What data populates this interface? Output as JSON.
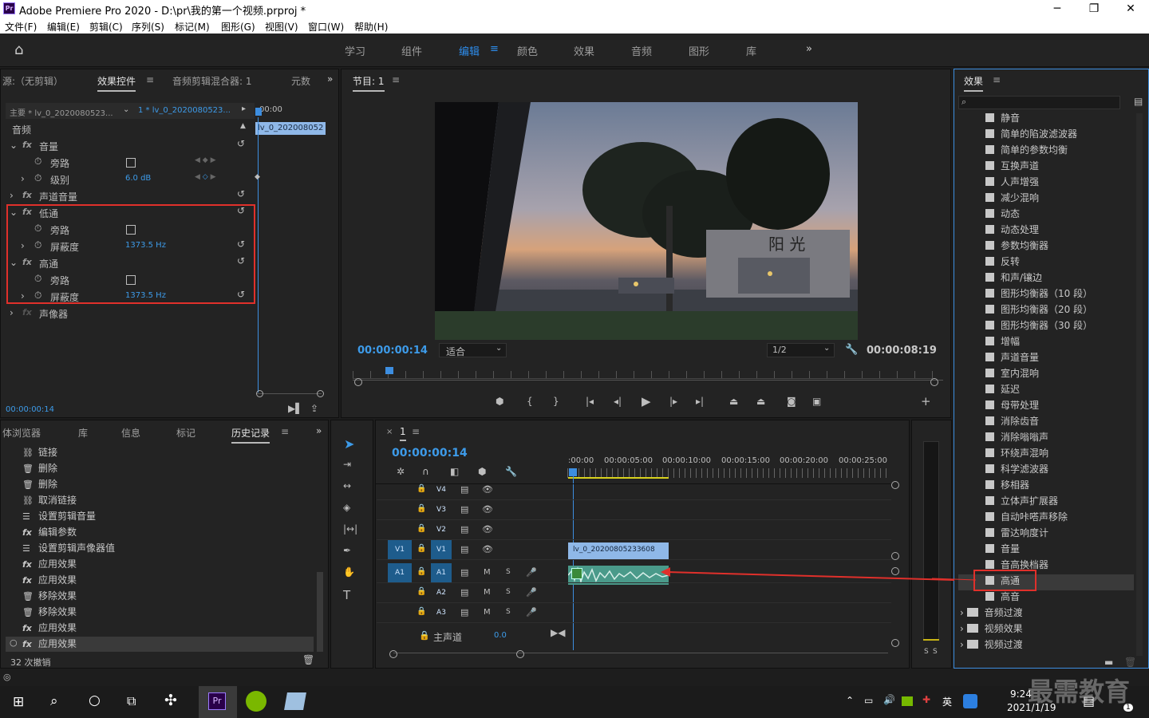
{
  "window": {
    "title": "Adobe Premiere Pro 2020 - D:\\pr\\我的第一个视频.prproj *",
    "app_icon": "Pr",
    "controls": [
      "─",
      "❐",
      "✕"
    ]
  },
  "menu": [
    "文件(F)",
    "编辑(E)",
    "剪辑(C)",
    "序列(S)",
    "标记(M)",
    "图形(G)",
    "视图(V)",
    "窗口(W)",
    "帮助(H)"
  ],
  "workspaces": [
    "学习",
    "组件",
    "编辑",
    "颜色",
    "效果",
    "音频",
    "图形",
    "库"
  ],
  "workspace_active": "编辑",
  "effect_controls": {
    "tabs": [
      "源:（无剪辑）",
      "效果控件",
      "音频剪辑混合器: 1",
      "元数"
    ],
    "master": "主要 * lv_0_2020080523...",
    "clip_select": "1 * lv_0_2020080523...",
    "timecode_head": "00:00",
    "clip_bar": "lv_0_202008052",
    "section": "音频",
    "rows": [
      {
        "label": "音量",
        "fx": true
      },
      {
        "label": "旁路",
        "check": true
      },
      {
        "label": "级别",
        "value": "6.0 dB"
      },
      {
        "label": "声道音量",
        "fx": true
      },
      {
        "label": "低通",
        "fx": true
      },
      {
        "label": "旁路",
        "check": true
      },
      {
        "label": "屏蔽度",
        "value": "1373.5  Hz"
      },
      {
        "label": "高通",
        "fx": true
      },
      {
        "label": "旁路",
        "check": true
      },
      {
        "label": "屏蔽度",
        "value": "1373.5  Hz"
      },
      {
        "label": "声像器",
        "fx": true
      }
    ],
    "time": "00:00:00:14"
  },
  "program": {
    "tab": "节目: 1",
    "timecode": "00:00:00:14",
    "fit": "适合",
    "res": "1/2",
    "duration": "00:00:08:19",
    "video_text": "阳 光"
  },
  "history": {
    "tabs": [
      "体浏览器",
      "库",
      "信息",
      "标记",
      "历史记录"
    ],
    "items": [
      {
        "icon": "link-icon",
        "label": "链接"
      },
      {
        "icon": "trash-icon",
        "label": "删除"
      },
      {
        "icon": "trash-icon",
        "label": "删除"
      },
      {
        "icon": "link-icon",
        "label": "取消链接"
      },
      {
        "icon": "list-icon",
        "label": "设置剪辑音量"
      },
      {
        "icon": "fx-icon",
        "label": "编辑参数"
      },
      {
        "icon": "list-icon",
        "label": "设置剪辑声像器值"
      },
      {
        "icon": "fx-icon",
        "label": "应用效果"
      },
      {
        "icon": "fx-icon",
        "label": "应用效果"
      },
      {
        "icon": "trash-icon",
        "label": "移除效果"
      },
      {
        "icon": "trash-icon",
        "label": "移除效果"
      },
      {
        "icon": "fx-icon",
        "label": "应用效果"
      },
      {
        "icon": "fx-icon",
        "label": "应用效果"
      }
    ],
    "footer": "32 次撤销"
  },
  "timeline": {
    "tab": "1",
    "timecode": "00:00:00:14",
    "ruler": [
      ":00:00",
      "00:00:05:00",
      "00:00:10:00",
      "00:00:15:00",
      "00:00:20:00",
      "00:00:25:00"
    ],
    "tracks": [
      {
        "name": "V4",
        "src": ""
      },
      {
        "name": "V3",
        "src": ""
      },
      {
        "name": "V2",
        "src": ""
      },
      {
        "name": "V1",
        "src": "V1"
      },
      {
        "name": "A1",
        "src": "A1"
      },
      {
        "name": "A2",
        "src": ""
      },
      {
        "name": "A3",
        "src": ""
      }
    ],
    "master_label": "主声道",
    "master_value": "0.0",
    "video_clip": "lv_0_20200805233608",
    "m": "M",
    "s": "S"
  },
  "meter": {
    "labels": [
      "S",
      "S"
    ]
  },
  "effects": {
    "tab": "效果",
    "items": [
      "静音",
      "简单的陷波滤波器",
      "简单的参数均衡",
      "互换声道",
      "人声增强",
      "减少混响",
      "动态",
      "动态处理",
      "参数均衡器",
      "反转",
      "和声/镶边",
      "图形均衡器（10 段）",
      "图形均衡器（20 段）",
      "图形均衡器（30 段）",
      "增幅",
      "声道音量",
      "室内混响",
      "延迟",
      "母带处理",
      "消除齿音",
      "消除嗡嗡声",
      "环绕声混响",
      "科学滤波器",
      "移相器",
      "立体声扩展器",
      "自动咔嗒声移除",
      "雷达响度计",
      "音量",
      "音高换档器",
      "高通",
      "高音"
    ],
    "highlighted": "高通",
    "folders": [
      "音频过渡",
      "视频效果",
      "视频过渡"
    ]
  },
  "taskbar": {
    "time": "9:24",
    "date": "2021/1/19",
    "ime": "英",
    "watermark": "最需教育",
    "badge": "1"
  },
  "colors": {
    "accent": "#2d8ceb",
    "highlight": "#e0302b",
    "clip_video": "#8fb8e8",
    "clip_audio": "#4a9a8a"
  }
}
